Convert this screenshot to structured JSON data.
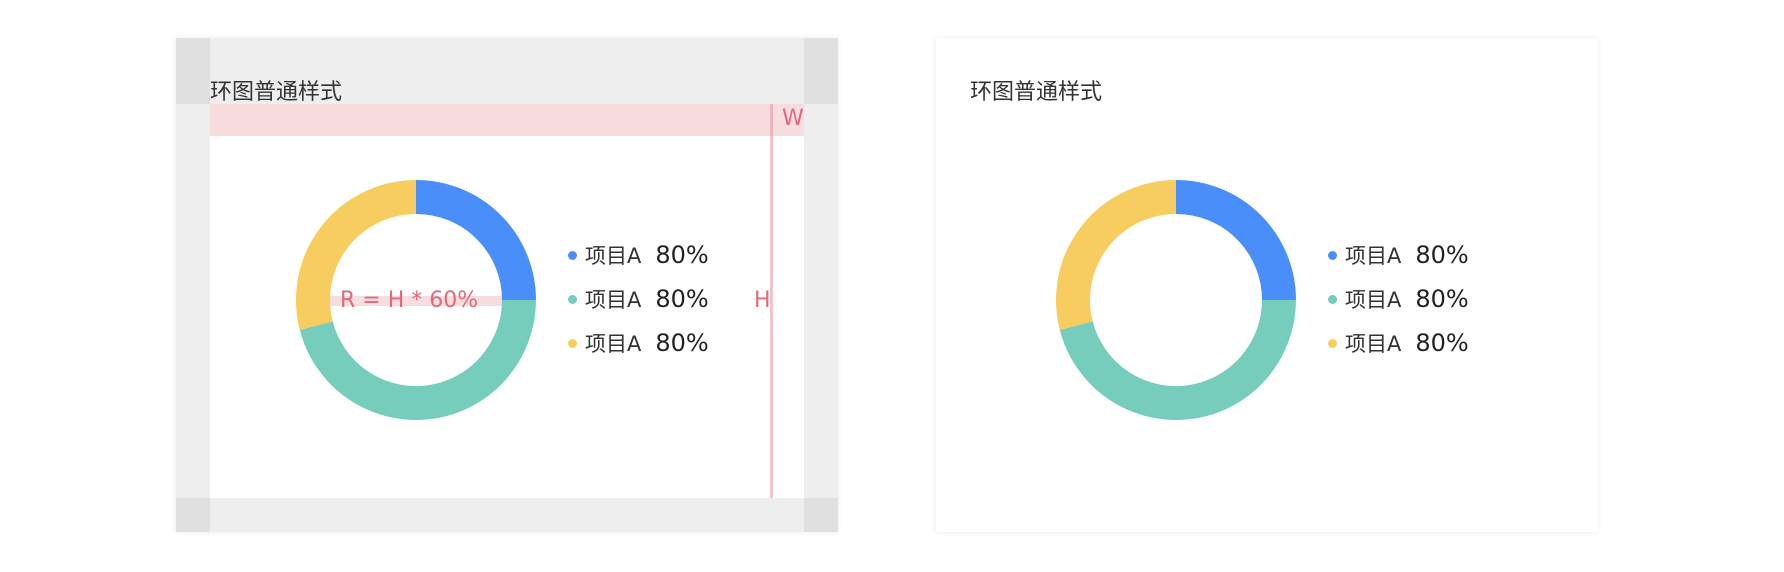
{
  "chart_data": [
    {
      "type": "pie",
      "variant": "donut",
      "title": "环图普通样式",
      "slices": [
        {
          "label": "项目A",
          "value": 80,
          "display": "80%",
          "color": "#4a8ff9"
        },
        {
          "label": "项目A",
          "value": 80,
          "display": "80%",
          "color": "#76cdbb"
        },
        {
          "label": "项目A",
          "value": 80,
          "display": "80%",
          "color": "#f6cd5e"
        }
      ],
      "arc_fractions": [
        0.25,
        0.46,
        0.29
      ],
      "legend_position": "right",
      "annotations": {
        "width_label": "W",
        "height_label": "H",
        "radius_formula": "R = H * 60%"
      }
    },
    {
      "type": "pie",
      "variant": "donut",
      "title": "环图普通样式",
      "slices": [
        {
          "label": "项目A",
          "value": 80,
          "display": "80%",
          "color": "#4a8ff9"
        },
        {
          "label": "项目A",
          "value": 80,
          "display": "80%",
          "color": "#76cdbb"
        },
        {
          "label": "项目A",
          "value": 80,
          "display": "80%",
          "color": "#f6cd5e"
        }
      ],
      "arc_fractions": [
        0.25,
        0.46,
        0.29
      ],
      "legend_position": "right"
    }
  ]
}
